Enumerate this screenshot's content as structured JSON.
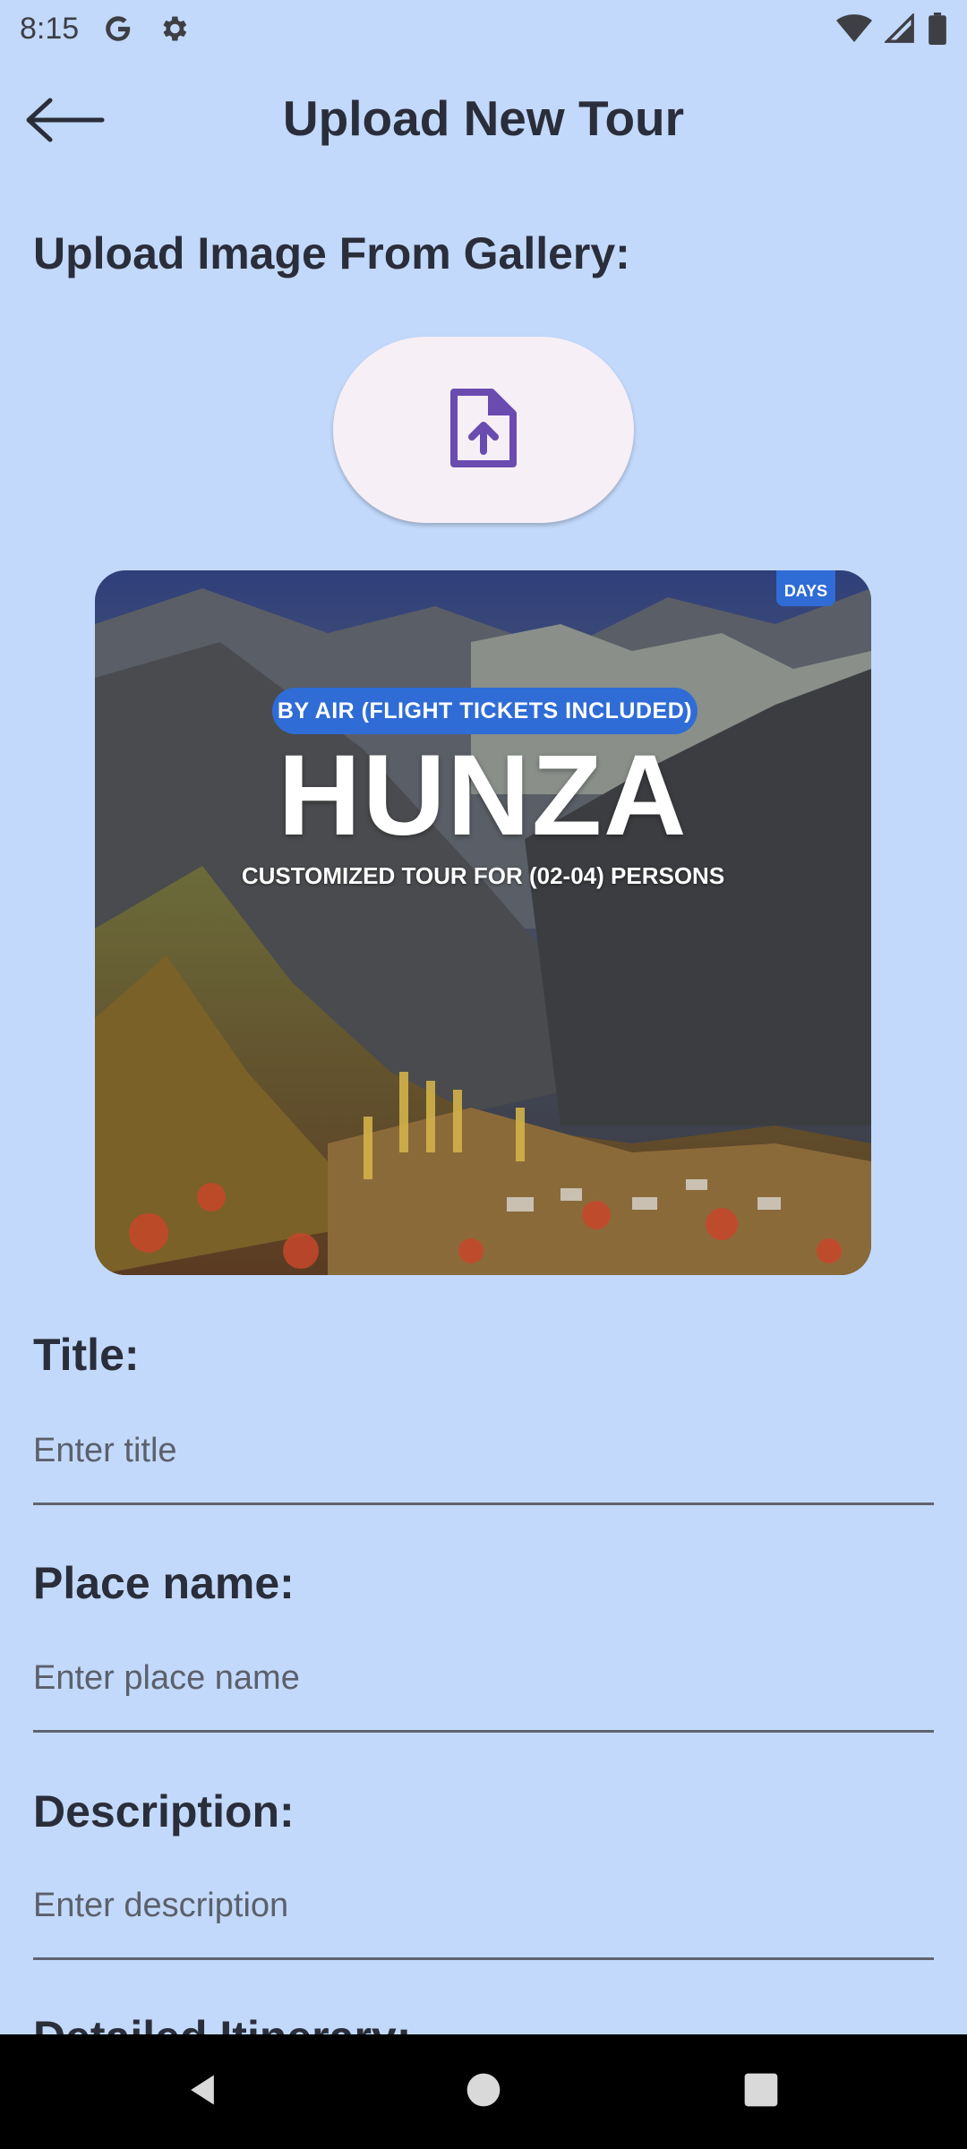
{
  "status_bar": {
    "time": "8:15",
    "icons": [
      "google-icon",
      "settings-icon",
      "wifi-icon",
      "signal-icon",
      "battery-icon"
    ]
  },
  "app_bar": {
    "title": "Upload New Tour",
    "back_icon": "arrow-left-icon"
  },
  "upload": {
    "label": "Upload Image From Gallery:",
    "button_icon": "file-upload-icon"
  },
  "tour_image": {
    "badge": "BY AIR (FLIGHT TICKETS INCLUDED)",
    "headline": "HUNZA",
    "subtitle": "CUSTOMIZED TOUR FOR (02-04) PERSONS",
    "days_badge": "DAYS"
  },
  "form": {
    "title": {
      "label": "Title:",
      "placeholder": "Enter title"
    },
    "place": {
      "label": "Place name:",
      "placeholder": "Enter place name"
    },
    "description": {
      "label": "Description:",
      "placeholder": "Enter description"
    },
    "itinerary": {
      "label": "Detailed Itinerary:"
    }
  },
  "nav": {
    "icons": [
      "back-triangle-icon",
      "home-circle-icon",
      "recents-square-icon"
    ]
  },
  "colors": {
    "background": "#c2d9fb",
    "upload_button": "#f6eff6",
    "accent_icon": "#6a4bb0",
    "badge_blue": "#2f6cd6"
  }
}
